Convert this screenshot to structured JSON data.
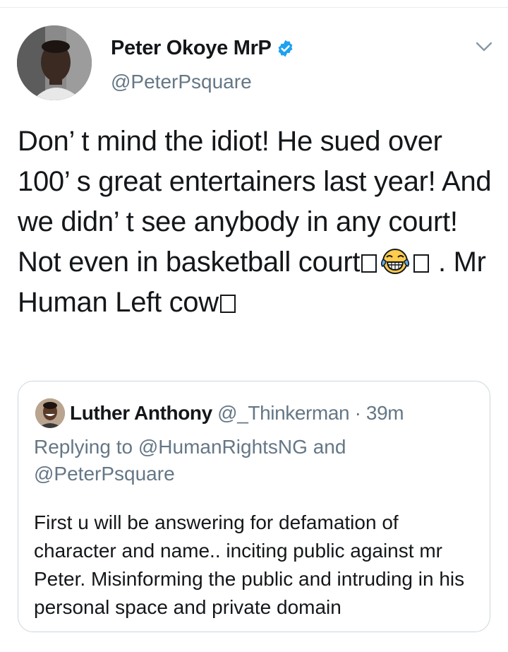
{
  "tweet": {
    "author": {
      "display_name": "Peter Okoye MrP",
      "handle": "@PeterPsquare",
      "verified": true,
      "avatar_icon": "profile-photo"
    },
    "text_parts": {
      "line1": "Don’ t mind the idiot! He sued over 100’ s great entertainers last year! And we didn’ t see anybody in any court! Not even in basketball court",
      "after_emoji": " . Mr Human Left cow"
    },
    "emoji": "face-with-tears-of-joy-icon",
    "menu_icon": "chevron-down-icon"
  },
  "quote": {
    "author_name": "Luther Anthony",
    "author_handle": "@_Thinkerman",
    "separator": "·",
    "time": "39m",
    "replying_prefix": "Replying to",
    "replying_to_1": "@HumanRightsNG",
    "replying_and": "and",
    "replying_to_2": "@PeterPsquare",
    "body": "First u will be answering for defamation of character and name.. inciting public against mr Peter. Misinforming the public and intruding in his personal space and private domain"
  },
  "colors": {
    "text": "#14171a",
    "secondary": "#657786",
    "verified_blue": "#1da1f2",
    "border": "#ccd6dd"
  }
}
